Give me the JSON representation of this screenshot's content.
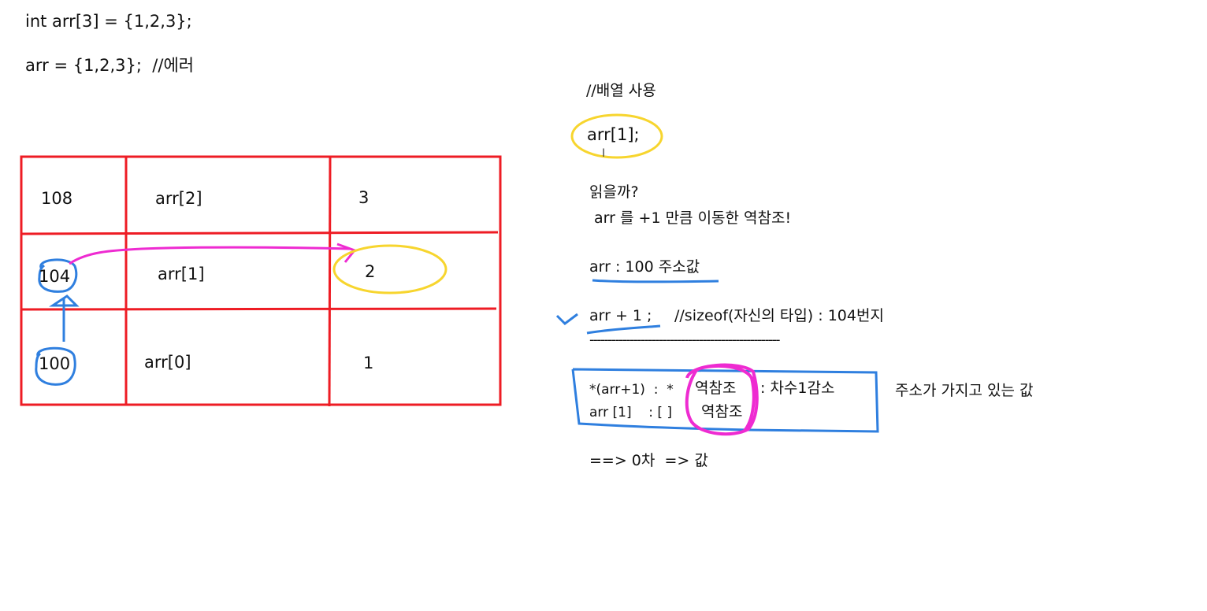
{
  "code": {
    "line1": "int arr[3] = {1,2,3};",
    "line2": "arr = {1,2,3};  //에러"
  },
  "memory_table": {
    "rows": [
      {
        "address": "108",
        "name": "arr[2]",
        "value": "3"
      },
      {
        "address": "104",
        "name": "arr[1]",
        "value": "2"
      },
      {
        "address": "100",
        "name": "arr[0]",
        "value": "1"
      }
    ]
  },
  "notes": {
    "comment_usage": "//배열 사용",
    "arr_index": "arr[1];",
    "question": "읽을까?",
    "explanation": " arr 를 +1 만큼 이동한 역참조!",
    "addr_value": "arr : 100 주소값",
    "arr_plus_one": "arr + 1 ;",
    "sizeof_comment": "//sizeof(자신의 타입) : 104번지",
    "divider": "----------------------------------------------------",
    "deref_expr": "*(arr+1)  :  *",
    "deref_label": "역참조",
    "deref_desc": ": 차수1감소",
    "index_expr": "arr [1]    : [ ]",
    "index_label": "역참조",
    "side_note": "주소가 가지고 있는 값",
    "result": "==> 0차  => 값"
  },
  "colors": {
    "table_red": "#ee1c24",
    "ink_blue": "#2f7fdf",
    "ink_magenta": "#ee2bd1",
    "ink_yellow": "#f7d52e"
  }
}
